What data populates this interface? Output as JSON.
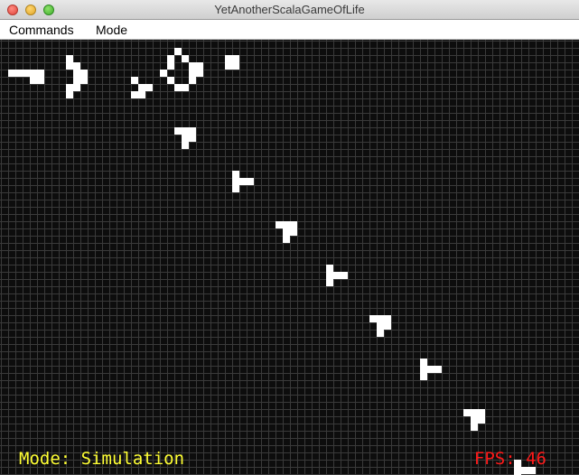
{
  "window": {
    "title": "YetAnotherScalaGameOfLife"
  },
  "menu": {
    "items": [
      "Commands",
      "Mode"
    ]
  },
  "status": {
    "mode_text": "Mode: Simulation",
    "fps_text": "FPS: 46"
  },
  "board": {
    "background": "#0d0d0d",
    "grid_color": "#3a3a3a",
    "live_cell_color": "#ffffff",
    "live_cells": [
      [
        1,
        4
      ],
      [
        2,
        4
      ],
      [
        3,
        4
      ],
      [
        4,
        4
      ],
      [
        5,
        4
      ],
      [
        4,
        5
      ],
      [
        5,
        5
      ],
      [
        9,
        2
      ],
      [
        9,
        3
      ],
      [
        10,
        3
      ],
      [
        10,
        4
      ],
      [
        11,
        4
      ],
      [
        11,
        5
      ],
      [
        10,
        5
      ],
      [
        10,
        6
      ],
      [
        9,
        6
      ],
      [
        9,
        7
      ],
      [
        24,
        1
      ],
      [
        23,
        2
      ],
      [
        25,
        2
      ],
      [
        23,
        3
      ],
      [
        26,
        3
      ],
      [
        22,
        4
      ],
      [
        26,
        4
      ],
      [
        23,
        5
      ],
      [
        26,
        5
      ],
      [
        24,
        6
      ],
      [
        25,
        6
      ],
      [
        27,
        3
      ],
      [
        27,
        4
      ],
      [
        31,
        2
      ],
      [
        32,
        2
      ],
      [
        31,
        3
      ],
      [
        32,
        3
      ],
      [
        18,
        5
      ],
      [
        19,
        6
      ],
      [
        20,
        6
      ],
      [
        18,
        7
      ],
      [
        19,
        7
      ],
      [
        24,
        12
      ],
      [
        25,
        12
      ],
      [
        26,
        12
      ],
      [
        25,
        13
      ],
      [
        26,
        13
      ],
      [
        25,
        14
      ],
      [
        32,
        18
      ],
      [
        32,
        19
      ],
      [
        33,
        19
      ],
      [
        34,
        19
      ],
      [
        32,
        20
      ],
      [
        38,
        25
      ],
      [
        39,
        25
      ],
      [
        40,
        25
      ],
      [
        39,
        26
      ],
      [
        40,
        26
      ],
      [
        39,
        27
      ],
      [
        45,
        31
      ],
      [
        45,
        32
      ],
      [
        46,
        32
      ],
      [
        47,
        32
      ],
      [
        45,
        33
      ],
      [
        51,
        38
      ],
      [
        52,
        38
      ],
      [
        53,
        38
      ],
      [
        52,
        39
      ],
      [
        53,
        39
      ],
      [
        52,
        40
      ],
      [
        58,
        44
      ],
      [
        58,
        45
      ],
      [
        59,
        45
      ],
      [
        60,
        45
      ],
      [
        58,
        46
      ],
      [
        64,
        51
      ],
      [
        65,
        51
      ],
      [
        66,
        51
      ],
      [
        65,
        52
      ],
      [
        66,
        52
      ],
      [
        65,
        53
      ],
      [
        71,
        58
      ],
      [
        71,
        59
      ],
      [
        72,
        59
      ],
      [
        73,
        59
      ],
      [
        71,
        60
      ]
    ]
  }
}
